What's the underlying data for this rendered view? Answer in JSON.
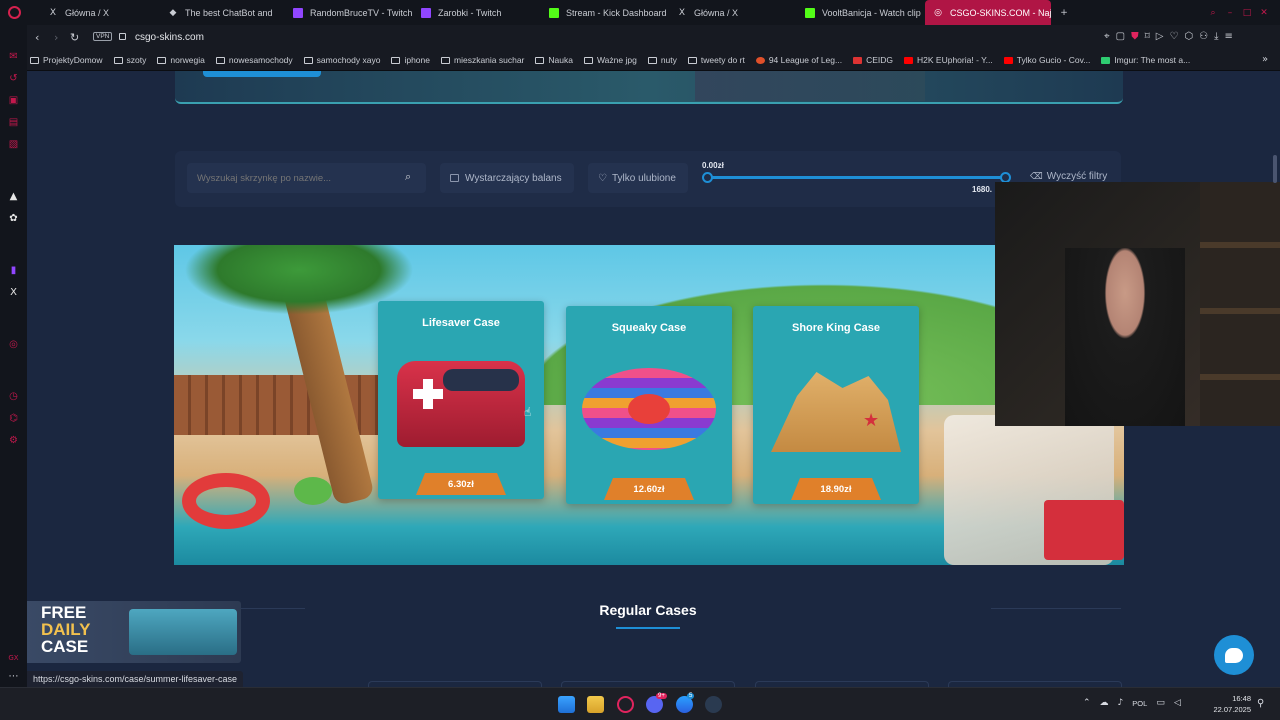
{
  "tabs": [
    {
      "title": "Główna / X",
      "icon": "x-icon"
    },
    {
      "title": "The best ChatBot and",
      "icon": "chatbot-icon"
    },
    {
      "title": "RandomBruceTV - Twitch",
      "icon": "twitch-icon"
    },
    {
      "title": "Zarobki - Twitch",
      "icon": "twitch-icon"
    },
    {
      "title": "Stream - Kick Dashboard",
      "icon": "kick-icon"
    },
    {
      "title": "Główna / X",
      "icon": "x-icon"
    },
    {
      "title": "VooltBanicja - Watch clip",
      "icon": "kick-icon"
    },
    {
      "title": "CSGO-SKINS.COM - Naj",
      "icon": "csgo-icon"
    }
  ],
  "address": {
    "vpn": "VPN",
    "url": "csgo-skins.com"
  },
  "bookmarks": [
    "ProjektyDomow",
    "szoty",
    "norwegia",
    "nowesamochody",
    "samochody xayo",
    "iphone",
    "mieszkania suchar",
    "Nauka",
    "Ważne jpg",
    "nuty",
    "tweety do rt",
    "94 League of Leg...",
    "CEIDG",
    "H2K EUphoria! - Y...",
    "Tylko Gucio - Cov...",
    "Imgur: The most a..."
  ],
  "filters": {
    "search_placeholder": "Wyszukaj skrzynkę po nazwie...",
    "balance_label": "Wystarczający balans",
    "favorites_label": "Tylko ulubione",
    "price_min": "0.00zł",
    "price_max": "1680.",
    "clear_label": "Wyczyść filtry"
  },
  "cases": [
    {
      "name": "Lifesaver Case",
      "price": "6.30zł"
    },
    {
      "name": "Squeaky Case",
      "price": "12.60zł"
    },
    {
      "name": "Shore King Case",
      "price": "18.90zł"
    }
  ],
  "section_title": "Regular Cases",
  "promo": {
    "line1": "FREE",
    "line2": "DAILY",
    "line3": "CASE"
  },
  "status_url": "https://csgo-skins.com/case/summer-lifesaver-case",
  "taskbar": {
    "lang": "POL",
    "time": "16:48",
    "date": "22.07.2025",
    "discord_badge": "9+",
    "messenger_badge": "5"
  },
  "colors": {
    "accent": "#e0802a",
    "brand": "#b01545",
    "slider": "#1e8fd6",
    "page_bg": "#1b2740"
  }
}
